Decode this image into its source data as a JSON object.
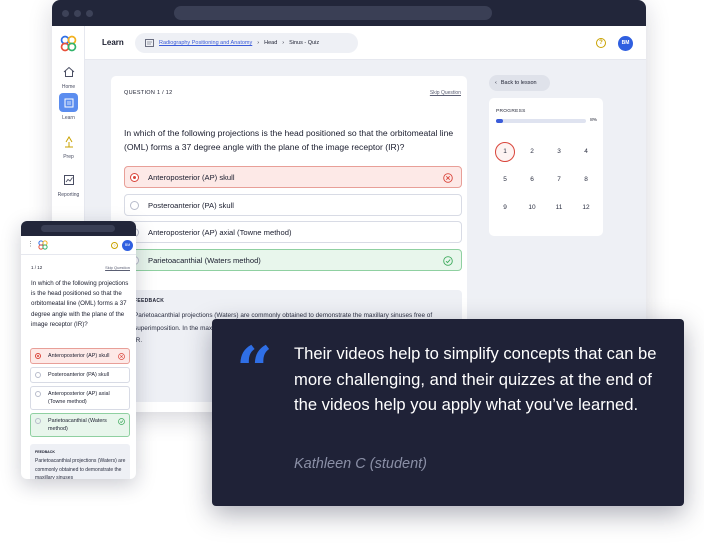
{
  "desktop": {
    "topbar": {
      "section": "Learn",
      "breadcrumb": {
        "course": "Radiography Positioning and Anatomy",
        "sep1": "›",
        "part": "Head",
        "sep2": "›",
        "page": "Sinus - Quiz"
      },
      "help": "?",
      "avatar": "BM"
    },
    "sidebar": [
      {
        "label": "Home",
        "icon": "home-icon"
      },
      {
        "label": "Learn",
        "icon": "learn-icon",
        "active": true
      },
      {
        "label": "Prep",
        "icon": "prep-icon"
      },
      {
        "label": "Reporting",
        "icon": "chart-icon"
      }
    ],
    "question": {
      "number": "QUESTION 1 / 12",
      "skip": "Skip Question",
      "text": "In which of the following projections is the head positioned so that the orbitomeatal line (OML) forms a 37 degree angle with the plane of the image receptor (IR)?",
      "options": [
        {
          "label": "Anteroposterior (AP) skull",
          "state": "wrong"
        },
        {
          "label": "Posteroanterior (PA) skull",
          "state": "none"
        },
        {
          "label": "Anteroposterior (AP) axial (Towne method)",
          "state": "none"
        },
        {
          "label": "Parietoacanthial (Waters method)",
          "state": "correct"
        }
      ]
    },
    "feedback": {
      "heading": "FEEDBACK",
      "text": "Parietoacanthial projections (Waters) are commonly obtained to demonstrate the maxillary sinuses free of superimposition. In the maxillary sinuses, the patient's head is positioned perpendicular and the head is with the IR."
    },
    "back_label": "Back to lesson",
    "progress": {
      "heading": "PROGRESS",
      "percent_label": "8%",
      "fraction": 0.08,
      "questions": [
        "1",
        "2",
        "3",
        "4",
        "5",
        "6",
        "7",
        "8",
        "9",
        "10",
        "11",
        "12"
      ],
      "current": "1"
    }
  },
  "mobile": {
    "qnum": "1 / 12",
    "skip": "Skip Question",
    "avatar": "BM",
    "text": "In which of the following projections is the head positioned so that the orbitomeatal line (OML) forms a 37 degree angle with the plane of the image receptor (IR)?",
    "options": [
      "Anteroposterior (AP) skull",
      "Posteroanterior (PA) skull",
      "Anteroposterior (AP) axial (Towne method)",
      "Parietoacanthial (Waters method)"
    ],
    "feedback_heading": "FEEDBACK",
    "feedback_text": "Parietoacanthial projections (Waters) are commonly obtained to demonstrate the maxillary sinuses"
  },
  "testimonial": {
    "mark": "“",
    "quote": "Their videos help to simplify concepts that can be more challenging, and their quizzes at the end of the videos help you apply what you’ve learned.",
    "author": "Kathleen C (student)"
  },
  "colors": {
    "accent": "#3a5bd9",
    "dark_panel": "#1f2237",
    "wrong": "#d9443a",
    "correct": "#3daa5c"
  }
}
